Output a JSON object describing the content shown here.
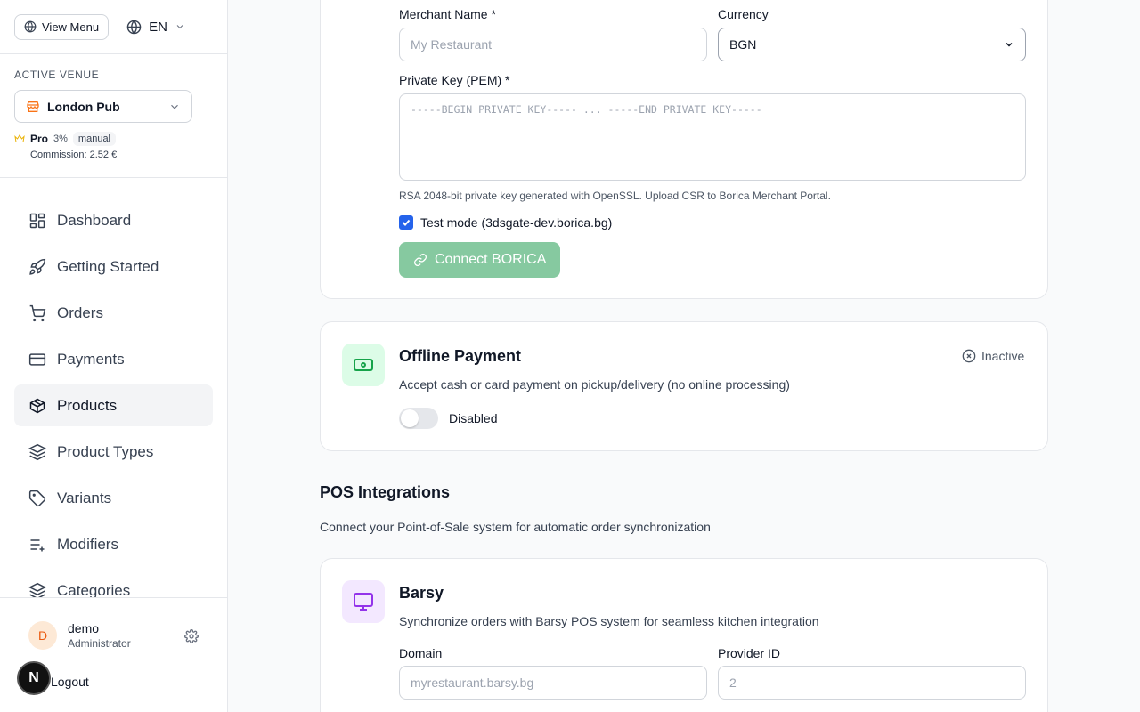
{
  "sidebar": {
    "view_menu_label": "View Menu",
    "language": "EN",
    "active_venue_label": "ACTIVE VENUE",
    "venue_name": "London Pub",
    "plan_name": "Pro",
    "plan_percent": "3%",
    "plan_badge": "manual",
    "commission": "Commission: 2.52 €",
    "nav": [
      {
        "label": "Dashboard",
        "icon": "dashboard-icon",
        "active": false
      },
      {
        "label": "Getting Started",
        "icon": "rocket-icon",
        "active": false
      },
      {
        "label": "Orders",
        "icon": "cart-icon",
        "active": false
      },
      {
        "label": "Payments",
        "icon": "credit-card-icon",
        "active": false
      },
      {
        "label": "Products",
        "icon": "package-icon",
        "active": true
      },
      {
        "label": "Product Types",
        "icon": "layers-icon",
        "active": false
      },
      {
        "label": "Variants",
        "icon": "tag-icon",
        "active": false
      },
      {
        "label": "Modifiers",
        "icon": "list-plus-icon",
        "active": false
      },
      {
        "label": "Categories",
        "icon": "layers-icon",
        "active": false
      }
    ],
    "user": {
      "initial": "D",
      "name": "demo",
      "role": "Administrator"
    },
    "logout_label": "Logout",
    "dev_badge": "N"
  },
  "borica": {
    "merchant_name_label": "Merchant Name *",
    "merchant_name_placeholder": "My Restaurant",
    "currency_label": "Currency",
    "currency_value": "BGN",
    "private_key_label": "Private Key (PEM) *",
    "private_key_placeholder": "-----BEGIN PRIVATE KEY----- ... -----END PRIVATE KEY-----",
    "private_key_help": "RSA 2048-bit private key generated with OpenSSL. Upload CSR to Borica Merchant Portal.",
    "test_mode_label": "Test mode (3dsgate-dev.borica.bg)",
    "test_mode_checked": true,
    "connect_label": "Connect BORICA"
  },
  "offline": {
    "title": "Offline Payment",
    "description": "Accept cash or card payment on pickup/delivery (no online processing)",
    "status": "Inactive",
    "toggle_label": "Disabled",
    "toggle_on": false
  },
  "pos": {
    "title": "POS Integrations",
    "description": "Connect your Point-of-Sale system for automatic order synchronization"
  },
  "barsy": {
    "title": "Barsy",
    "description": "Synchronize orders with Barsy POS system for seamless kitchen integration",
    "domain_label": "Domain",
    "domain_placeholder": "myrestaurant.barsy.bg",
    "provider_label": "Provider ID",
    "provider_placeholder": "2"
  },
  "colors": {
    "accent_green": "#86c9a0",
    "offline_icon": "#16a34a",
    "barsy_icon": "#9333ea",
    "venue_icon": "#f97316"
  }
}
